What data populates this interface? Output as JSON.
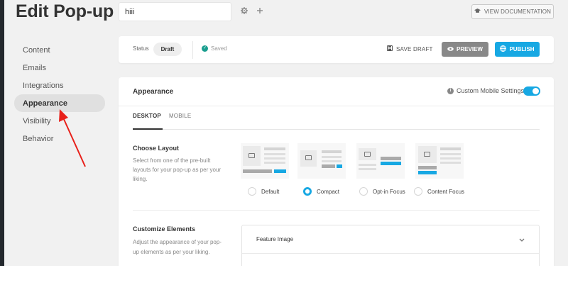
{
  "header": {
    "page_title": "Edit Pop-up",
    "name_value": "hiii",
    "name_placeholder": "",
    "view_docs_label": "VIEW DOCUMENTATION"
  },
  "sidebar": {
    "items": [
      {
        "label": "Content",
        "active": false
      },
      {
        "label": "Emails",
        "active": false
      },
      {
        "label": "Integrations",
        "active": false
      },
      {
        "label": "Appearance",
        "active": true
      },
      {
        "label": "Visibility",
        "active": false
      },
      {
        "label": "Behavior",
        "active": false
      }
    ]
  },
  "status_bar": {
    "status_label": "Status",
    "status_value": "Draft",
    "saved_label": "Saved",
    "save_draft_label": "SAVE DRAFT",
    "preview_label": "PREVIEW",
    "publish_label": "PUBLISH"
  },
  "appearance": {
    "title": "Appearance",
    "mobile_settings_label": "Custom Mobile Settings",
    "mobile_settings_enabled": true,
    "tabs": [
      {
        "label": "DESKTOP",
        "active": true
      },
      {
        "label": "MOBILE",
        "active": false
      }
    ],
    "choose_layout": {
      "title": "Choose Layout",
      "description": "Select from one of the pre-built layouts for your pop-up as per your liking.",
      "options": [
        {
          "label": "Default",
          "selected": false
        },
        {
          "label": "Compact",
          "selected": true
        },
        {
          "label": "Opt-in Focus",
          "selected": false
        },
        {
          "label": "Content Focus",
          "selected": false
        }
      ]
    },
    "customize": {
      "title": "Customize Elements",
      "description": "Adjust the appearance of your pop-up elements as per your liking.",
      "accordion": [
        {
          "label": "Feature Image"
        },
        {
          "label": ""
        }
      ]
    }
  },
  "colors": {
    "accent": "#17a8e3",
    "preview_button": "#888888",
    "saved_check": "#1a9e8f",
    "annotation_arrow": "#e8201a"
  },
  "icons": {
    "gear": "gear-icon",
    "plus": "plus-icon",
    "docs": "graduation-cap-icon",
    "save_draft": "floppy-icon",
    "preview": "eye-icon",
    "publish": "globe-icon",
    "info": "info-icon",
    "chevron": "chevron-down-icon"
  }
}
